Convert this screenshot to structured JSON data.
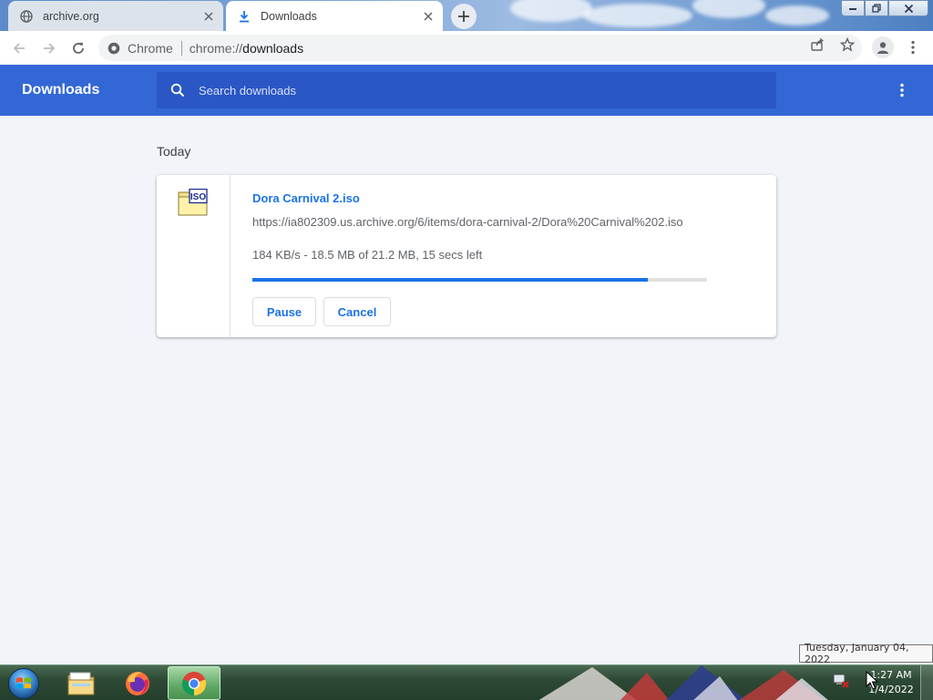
{
  "tabs": [
    {
      "title": "archive.org",
      "icon": "globe-icon",
      "active": false
    },
    {
      "title": "Downloads",
      "icon": "download-icon",
      "active": true
    }
  ],
  "toolbar": {
    "site_chip": "Chrome",
    "url_scheme": "chrome://",
    "url_path": "downloads"
  },
  "downloads_page": {
    "title": "Downloads",
    "search_placeholder": "Search downloads",
    "section": "Today",
    "item": {
      "icon": "iso-file-icon",
      "icon_label": "ISO",
      "filename": "Dora Carnival 2.iso",
      "url": "https://ia802309.us.archive.org/6/items/dora-carnival-2/Dora%20Carnival%202.iso",
      "status": "184 KB/s - 18.5 MB of 21.2 MB, 15 secs left",
      "progress_percent": 87,
      "pause_label": "Pause",
      "cancel_label": "Cancel"
    }
  },
  "colors": {
    "header_blue": "#3367d6",
    "accent": "#1a73e8"
  },
  "taskbar": {
    "apps": [
      "windows-explorer-icon",
      "firefox-icon",
      "chrome-icon"
    ],
    "clock_time": "1:27 AM",
    "clock_date": "1/4/2022",
    "tooltip": "Tuesday, January 04, 2022"
  }
}
